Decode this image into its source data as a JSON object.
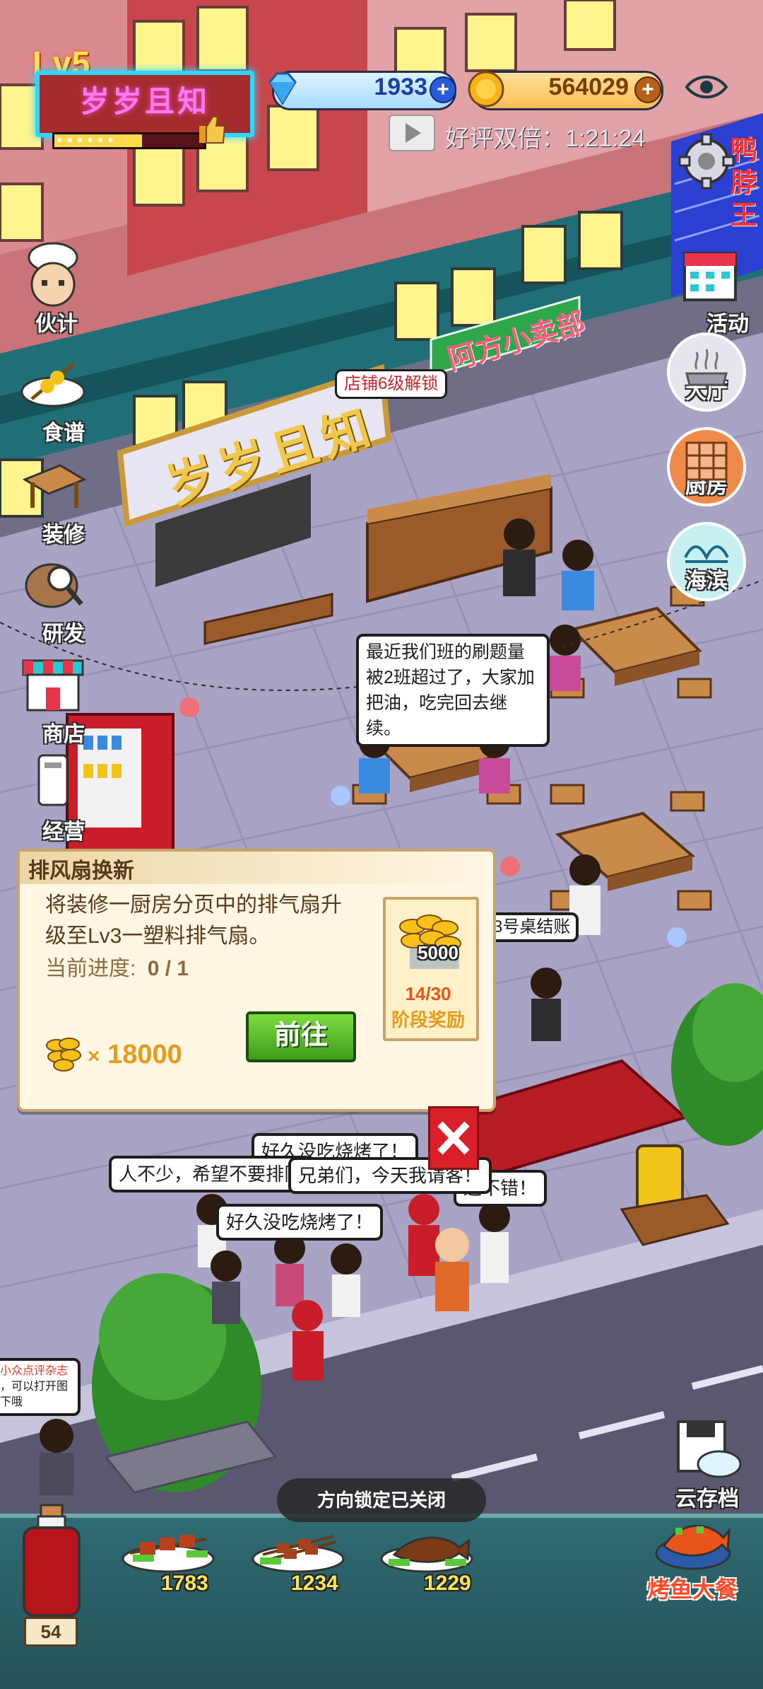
{
  "hud": {
    "level": "Lv5",
    "restaurant_name": "岁岁且知",
    "exp_fraction": 0.6,
    "gems": "1933",
    "coins": "564029",
    "double_praise_timer": "好评双倍：1:21:24",
    "shop_sign": "岁岁且知",
    "neighbor_shop_sign": "阿方小卖部",
    "right_shop_sign": "鸭脖王",
    "unlock_label": "店铺6级解锁"
  },
  "left_menu": [
    {
      "label": "伙计",
      "icon": "chef-icon"
    },
    {
      "label": "食谱",
      "icon": "recipe-icon"
    },
    {
      "label": "装修",
      "icon": "decor-icon"
    },
    {
      "label": "研发",
      "icon": "research-icon"
    },
    {
      "label": "商店",
      "icon": "shop-icon"
    },
    {
      "label": "经营",
      "icon": "manage-icon"
    }
  ],
  "right_menu": [
    {
      "label": "活动",
      "icon": "calendar-icon"
    },
    {
      "label": "大厅",
      "icon": "hall-icon"
    },
    {
      "label": "厨房",
      "icon": "kitchen-icon"
    },
    {
      "label": "海滨",
      "icon": "beach-icon"
    }
  ],
  "bubbles": {
    "students": "最近我们班的刷题量\n被2班超过了，大家加\n把油，吃完回去继续。",
    "checkout": "3号桌结账",
    "queue_1": "好久没吃烧烤了！",
    "queue_2": "人不少，希望不要排队",
    "queue_3": "兄弟们，今天我请客！",
    "queue_4": "这不错！",
    "queue_5": "好久没吃烧烤了！",
    "side_note_1": "小众点评杂志",
    "side_note_2": "，可以打开图",
    "side_note_3": "下哦"
  },
  "quest": {
    "title": "排风扇换新",
    "description": "将装修一厨房分页中的排气扇升级至Lv3一塑料排气扇。",
    "progress_label": "当前进度:",
    "progress_value": "0 / 1",
    "go_button": "前往",
    "reward_multiplier": "×",
    "reward_amount": "18000",
    "stage_reward_value": "5000",
    "stage_progress": "14/30",
    "stage_reward_label": "阶段奖励"
  },
  "toast": "方向锁定已关闭",
  "bottom": {
    "bottle_count": "54",
    "dishes": [
      {
        "name": "meat-skewer",
        "count": "1783"
      },
      {
        "name": "mixed-skewer",
        "count": "1234"
      },
      {
        "name": "grilled-fish",
        "count": "1229"
      }
    ],
    "cloud_save": "云存档",
    "fish_feast": "烤鱼大餐"
  },
  "colors": {
    "accent_cyan": "#2bd8ff",
    "neon_pink": "#ff7cf0",
    "go_green": "#4fb828",
    "reward_orange": "#e89a1c",
    "bar_teal": "#2f6b73"
  }
}
